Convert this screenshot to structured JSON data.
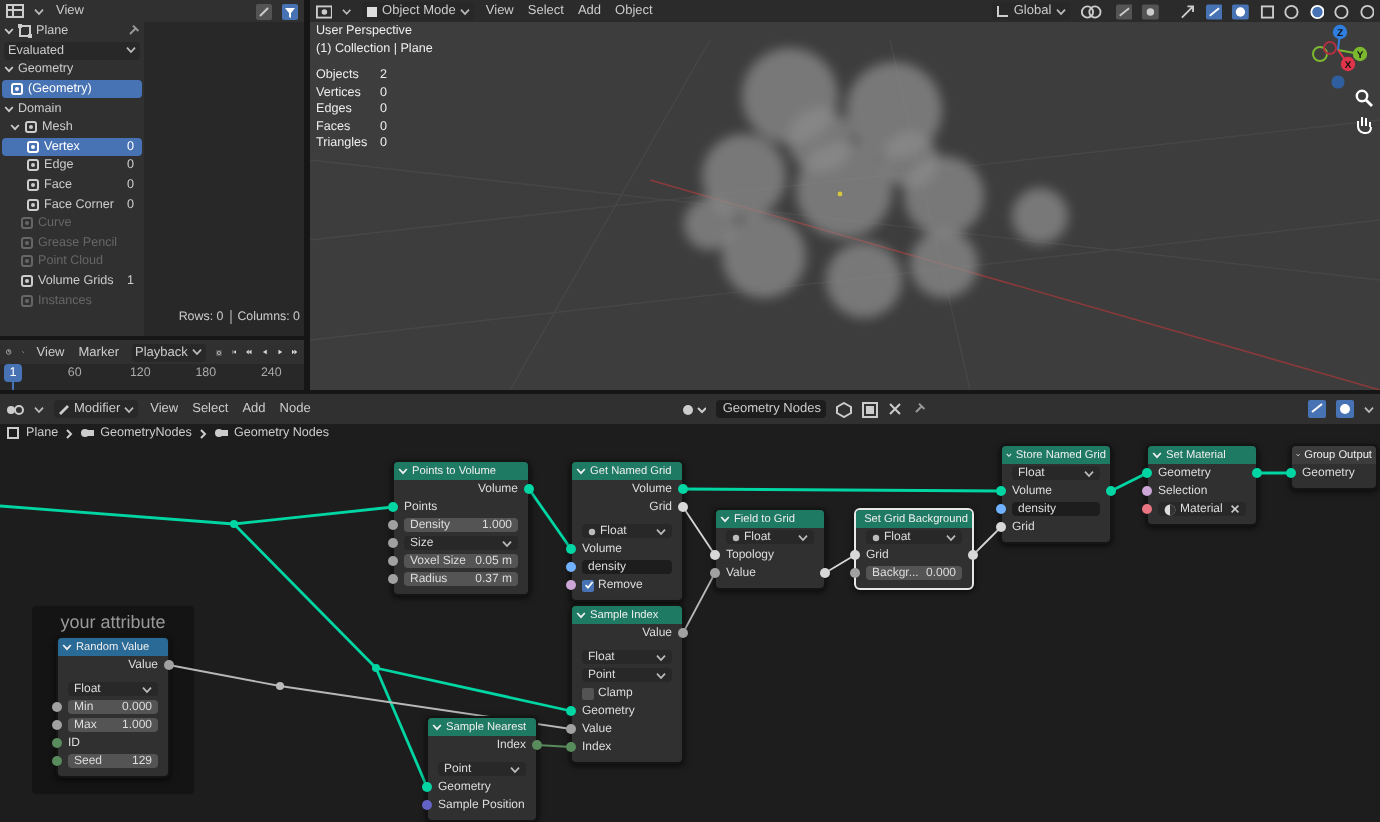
{
  "spreadsheet": {
    "menu": "View",
    "object": "Plane",
    "evaluation": "Evaluated",
    "sections": [
      {
        "label": "Geometry",
        "expanded": true,
        "items": [
          {
            "label": "(Geometry)",
            "selected": true,
            "disabled": false
          }
        ]
      },
      {
        "label": "Domain",
        "expanded": true,
        "items": [
          {
            "label": "Mesh",
            "selected": false,
            "disabled": false,
            "expanded": true,
            "children": [
              {
                "label": "Vertex",
                "count": "0",
                "selected": true,
                "disabled": false
              },
              {
                "label": "Edge",
                "count": "0",
                "selected": false,
                "disabled": false
              },
              {
                "label": "Face",
                "count": "0",
                "selected": false,
                "disabled": false
              },
              {
                "label": "Face Corner",
                "count": "0",
                "selected": false,
                "disabled": false
              }
            ]
          },
          {
            "label": "Curve",
            "selected": false,
            "disabled": true
          },
          {
            "label": "Grease Pencil",
            "selected": false,
            "disabled": true
          },
          {
            "label": "Point Cloud",
            "selected": false,
            "disabled": true
          },
          {
            "label": "Volume Grids",
            "count": "1",
            "selected": false,
            "disabled": false
          },
          {
            "label": "Instances",
            "selected": false,
            "disabled": true
          }
        ]
      }
    ],
    "rows": "Rows: 0",
    "columns": "Columns: 0"
  },
  "timeline": {
    "menus": [
      "View",
      "Marker",
      "Playback"
    ],
    "current_frame": "1",
    "ticks": [
      "60",
      "120",
      "180",
      "240"
    ]
  },
  "viewport": {
    "mode": "Object Mode",
    "menus": [
      "View",
      "Select",
      "Add",
      "Object"
    ],
    "orientation": "Global",
    "view_name": "User Perspective",
    "collection": "(1) Collection | Plane",
    "stats": [
      {
        "label": "Objects",
        "value": "2"
      },
      {
        "label": "Vertices",
        "value": "0"
      },
      {
        "label": "Edges",
        "value": "0"
      },
      {
        "label": "Faces",
        "value": "0"
      },
      {
        "label": "Triangles",
        "value": "0"
      }
    ],
    "gizmo_axes": [
      "Z",
      "Y",
      "X"
    ]
  },
  "node_editor": {
    "context": "Modifier",
    "menus": [
      "View",
      "Select",
      "Add",
      "Node"
    ],
    "node_group": "Geometry Nodes",
    "breadcrumbs": [
      "Plane",
      "GeometryNodes",
      "Geometry Nodes"
    ],
    "nodes": [
      {
        "title": "Points to Volume",
        "color": "#1f7a64",
        "selected": false,
        "rows": [
          {
            "kind": "socket",
            "label": "Volume",
            "sockets": [
              {
                "output": true,
                "color": "#00d6a3"
              }
            ]
          },
          {
            "kind": "socket",
            "label": "Points",
            "sockets": [
              {
                "output": false,
                "color": "#00d6a3"
              }
            ]
          },
          {
            "kind": "field",
            "label": "Density",
            "value": "1.000",
            "sockets": [
              {
                "output": false,
                "color": "#a1a1a1"
              }
            ]
          },
          {
            "kind": "dropdown",
            "label": "Size",
            "dot": false,
            "sockets": [
              {
                "output": false,
                "color": "#a1a1a1"
              }
            ]
          },
          {
            "kind": "field",
            "label": "Voxel Size",
            "value": "0.05 m",
            "sockets": [
              {
                "output": false,
                "color": "#a1a1a1"
              }
            ]
          },
          {
            "kind": "field",
            "label": "Radius",
            "value": "0.37 m",
            "sockets": [
              {
                "output": false,
                "color": "#a1a1a1"
              }
            ]
          }
        ]
      },
      {
        "title": "Get Named Grid",
        "color": "#1f7a64",
        "selected": false,
        "rows": [
          {
            "kind": "socket",
            "label": "Volume",
            "sockets": [
              {
                "output": true,
                "color": "#00d6a3"
              }
            ]
          },
          {
            "kind": "socket",
            "label": "Grid",
            "sockets": [
              {
                "output": true,
                "color": "#d8d8d8"
              }
            ]
          },
          {
            "kind": "dropdown",
            "label": "Float",
            "dot": true
          },
          {
            "kind": "socket",
            "label": "Volume",
            "sockets": [
              {
                "output": false,
                "color": "#00d6a3"
              }
            ]
          },
          {
            "kind": "text",
            "value": "density",
            "sockets": [
              {
                "output": false,
                "color": "#70b2ff"
              }
            ]
          },
          {
            "kind": "checkbox",
            "label": "Remove",
            "checked": true,
            "sockets": [
              {
                "output": false,
                "color": "#cca6d6"
              }
            ]
          }
        ]
      },
      {
        "title": "Field to Grid",
        "color": "#1f7a64",
        "selected": false,
        "rows": [
          {
            "kind": "dropdown",
            "label": "Float",
            "dot": true
          },
          {
            "kind": "socket",
            "label": "Topology",
            "sockets": [
              {
                "output": false,
                "color": "#d8d8d8"
              }
            ]
          },
          {
            "kind": "socket",
            "label": "Value",
            "sockets": [
              {
                "output": false,
                "color": "#a1a1a1"
              },
              {
                "output": true,
                "color": "#d8d8d8"
              }
            ]
          }
        ]
      },
      {
        "title": "Set Grid Background",
        "color": "#1f7a64",
        "selected": true,
        "rows": [
          {
            "kind": "dropdown",
            "label": "Float",
            "dot": true
          },
          {
            "kind": "socket",
            "label": "Grid",
            "sockets": [
              {
                "output": false,
                "color": "#d8d8d8"
              },
              {
                "output": true,
                "color": "#d8d8d8"
              }
            ]
          },
          {
            "kind": "field",
            "label": "Backgr...",
            "value": "0.000",
            "sockets": [
              {
                "output": false,
                "color": "#a1a1a1"
              }
            ]
          }
        ]
      },
      {
        "title": "Store Named Grid",
        "color": "#1f7a64",
        "selected": false,
        "rows": [
          {
            "kind": "dropdown",
            "label": "Float",
            "dot": false
          },
          {
            "kind": "socket",
            "label": "Volume",
            "sockets": [
              {
                "output": false,
                "color": "#00d6a3"
              },
              {
                "output": true,
                "color": "#00d6a3"
              }
            ]
          },
          {
            "kind": "text",
            "value": "density",
            "sockets": [
              {
                "output": false,
                "color": "#70b2ff"
              }
            ]
          },
          {
            "kind": "socket",
            "label": "Grid",
            "sockets": [
              {
                "output": false,
                "color": "#d8d8d8"
              }
            ]
          }
        ]
      },
      {
        "title": "Set Material",
        "color": "#1f7a64",
        "selected": false,
        "rows": [
          {
            "kind": "socket",
            "label": "Geometry",
            "sockets": [
              {
                "output": false,
                "color": "#00d6a3"
              },
              {
                "output": true,
                "color": "#00d6a3"
              }
            ]
          },
          {
            "kind": "socket",
            "label": "Selection",
            "sockets": [
              {
                "output": false,
                "color": "#cca6d6"
              }
            ]
          },
          {
            "kind": "material",
            "label": "Material",
            "sockets": [
              {
                "output": false,
                "color": "#eb7582"
              }
            ]
          }
        ]
      },
      {
        "title": "Group Output",
        "color": "#3c3c3c",
        "selected": false,
        "rows": [
          {
            "kind": "socket",
            "label": "Geometry",
            "sockets": [
              {
                "output": false,
                "color": "#00d6a3"
              }
            ]
          }
        ]
      },
      {
        "title": "Random Value",
        "color": "#2a6a96",
        "selected": false,
        "frame": "your attribute",
        "rows": [
          {
            "kind": "socket",
            "label": "Value",
            "sockets": [
              {
                "output": true,
                "color": "#a1a1a1"
              }
            ]
          },
          {
            "kind": "dropdown",
            "label": "Float",
            "dot": false
          },
          {
            "kind": "field",
            "label": "Min",
            "value": "0.000",
            "sockets": [
              {
                "output": false,
                "color": "#a1a1a1"
              }
            ]
          },
          {
            "kind": "field",
            "label": "Max",
            "value": "1.000",
            "sockets": [
              {
                "output": false,
                "color": "#a1a1a1"
              }
            ]
          },
          {
            "kind": "socket",
            "label": "ID",
            "sockets": [
              {
                "output": false,
                "color": "#598c5c"
              }
            ]
          },
          {
            "kind": "field",
            "label": "Seed",
            "value": "129",
            "sockets": [
              {
                "output": false,
                "color": "#598c5c"
              }
            ]
          }
        ]
      },
      {
        "title": "Sample Nearest",
        "color": "#1f7a64",
        "selected": false,
        "rows": [
          {
            "kind": "socket",
            "label": "Index",
            "sockets": [
              {
                "output": true,
                "color": "#598c5c"
              }
            ]
          },
          {
            "kind": "dropdown",
            "label": "Point",
            "dot": false
          },
          {
            "kind": "socket",
            "label": "Geometry",
            "sockets": [
              {
                "output": false,
                "color": "#00d6a3"
              }
            ]
          },
          {
            "kind": "socket",
            "label": "Sample Position",
            "sockets": [
              {
                "output": false,
                "color": "#6363c7"
              }
            ]
          }
        ]
      },
      {
        "title": "Sample Index",
        "color": "#1f7a64",
        "selected": false,
        "rows": [
          {
            "kind": "socket",
            "label": "Value",
            "sockets": [
              {
                "output": true,
                "color": "#a1a1a1"
              }
            ]
          },
          {
            "kind": "dropdown",
            "label": "Float",
            "dot": false
          },
          {
            "kind": "dropdown",
            "label": "Point",
            "dot": false
          },
          {
            "kind": "checkbox",
            "label": "Clamp",
            "checked": false
          },
          {
            "kind": "socket",
            "label": "Geometry",
            "sockets": [
              {
                "output": false,
                "color": "#00d6a3"
              }
            ]
          },
          {
            "kind": "socket",
            "label": "Value",
            "sockets": [
              {
                "output": false,
                "color": "#a1a1a1"
              }
            ]
          },
          {
            "kind": "socket",
            "label": "Index",
            "sockets": [
              {
                "output": false,
                "color": "#598c5c"
              }
            ]
          }
        ]
      }
    ]
  }
}
